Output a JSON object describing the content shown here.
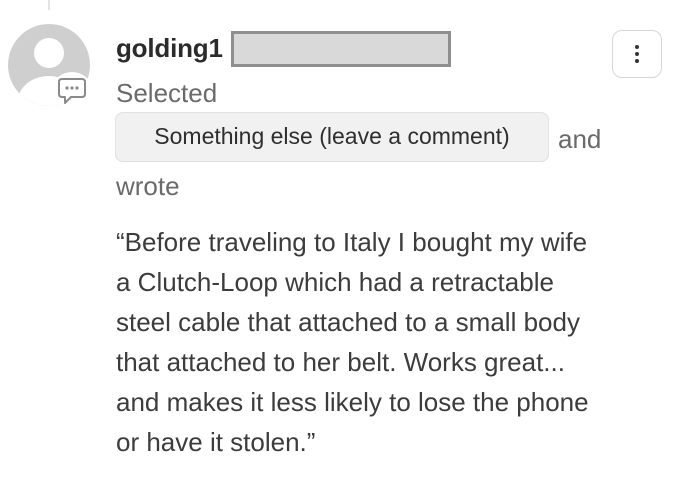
{
  "comment": {
    "username": "golding1",
    "username_redacted": true,
    "selected_label": "Selected",
    "choice": "Something else (leave a comment)",
    "and_label": "and",
    "wrote_label": "wrote",
    "quote_lines": [
      "“Before traveling to Italy I bought my wife",
      "a Clutch-Loop which had a retractable",
      "steel cable that attached to a small body",
      "that attached to her belt. Works great...",
      "and makes it less likely to lose the phone",
      "or have it stolen.”"
    ]
  },
  "icons": {
    "avatar": "default-user-avatar-icon",
    "badge": "comment-bubble-icon",
    "menu": "vertical-ellipsis-icon"
  },
  "colors": {
    "avatar_gray": "#cfcfcf",
    "redaction_fill": "#d9d9d9",
    "redaction_border": "#8f8f8f",
    "chip_background": "#f1f1f1",
    "secondary_text": "#6a6a6a"
  }
}
